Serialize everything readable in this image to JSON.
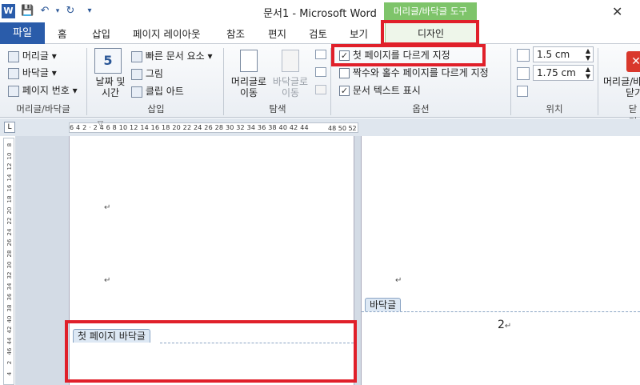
{
  "window": {
    "title": "문서1  -  Microsoft Word",
    "context_tab_label": "머리글/바닥글 도구",
    "app_icon": "W"
  },
  "tabs": [
    {
      "label": "파일"
    },
    {
      "label": "홈"
    },
    {
      "label": "삽입"
    },
    {
      "label": "페이지 레이아웃"
    },
    {
      "label": "참조"
    },
    {
      "label": "편지"
    },
    {
      "label": "검토"
    },
    {
      "label": "보기"
    },
    {
      "label": "디자인"
    }
  ],
  "ribbon": {
    "header_footer": {
      "header": "머리글 ▾",
      "footer": "바닥글 ▾",
      "page_number": "페이지 번호 ▾",
      "group_label": "머리글/바닥글"
    },
    "insert": {
      "date_time_l1": "날짜 및",
      "date_time_l2": "시간",
      "quick_parts": "빠른 문서 요소 ▾",
      "picture": "그림",
      "clip_art": "클립 아트",
      "group_label": "삽입",
      "calendar_digit": "5"
    },
    "navigation": {
      "goto_header_l1": "머리글로",
      "goto_header_l2": "이동",
      "goto_footer_l1": "바닥글로",
      "goto_footer_l2": "이동",
      "group_label": "탐색"
    },
    "options": {
      "different_first": "첫 페이지를 다르게 지정",
      "different_odd_even": "짝수와 홀수 페이지를 다르게 지정",
      "show_doc_text": "문서 텍스트 표시",
      "group_label": "옵션",
      "different_first_checked": true,
      "different_odd_even_checked": false,
      "show_doc_text_checked": true
    },
    "position": {
      "header_from_top": "1.5 cm",
      "footer_from_bottom": "1.75 cm",
      "group_label": "위치"
    },
    "close": {
      "label_l1": "머리글/바",
      "label_l2": "닫기",
      "group_label": "닫기"
    }
  },
  "ruler": {
    "ticks": "6  4  2  ·  2  4  6  8  10 12 14 16 18 20 22 24 26 28 30 32 34 36 38 40 42 44",
    "tail": "48 50 52"
  },
  "document": {
    "paragraph_mark": "↵",
    "first_page_footer_label": "첫 페이지 바닥글",
    "footer_label": "바닥글",
    "page_number_text": "2"
  }
}
